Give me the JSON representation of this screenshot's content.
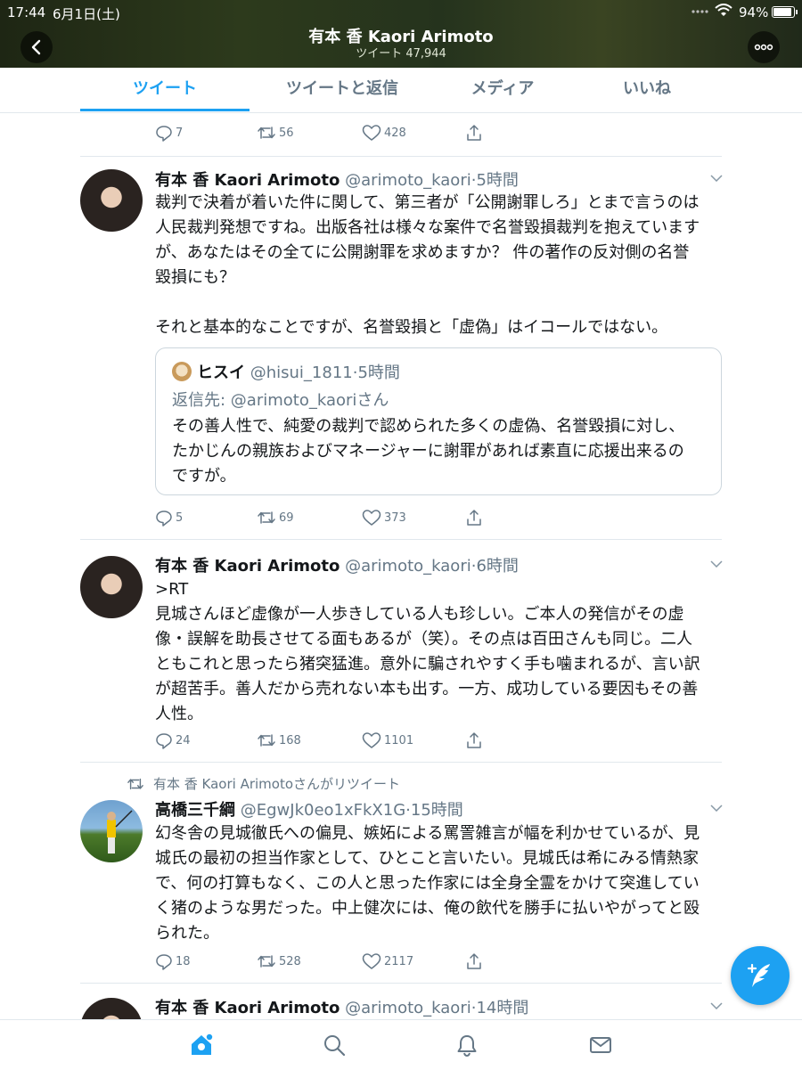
{
  "status_bar": {
    "time": "17:44",
    "date": "6月1日(土)",
    "battery": "94%"
  },
  "header": {
    "name": "有本 香  Kaori Arimoto",
    "tweet_count": "ツイート 47,944"
  },
  "tabs": [
    {
      "label": "ツイート",
      "active": true
    },
    {
      "label": "ツイートと返信",
      "active": false
    },
    {
      "label": "メディア",
      "active": false
    },
    {
      "label": "いいね",
      "active": false
    }
  ],
  "top_actions": {
    "replies": "7",
    "retweets": "56",
    "likes": "428"
  },
  "tweets": [
    {
      "name": "有本  香  Kaori Arimoto",
      "handle": "@arimoto_kaori",
      "time": "·5時間",
      "text_lines": [
        "裁判で決着が着いた件に関して、第三者が「公開謝罪しろ」とまで言うのは",
        "人民裁判発想ですね。出版各社は様々な案件で名誉毀損裁判を抱えています",
        "が、あなたはその全てに公開謝罪を求めますか？  件の著作の反対側の名誉",
        "毀損にも？",
        "",
        "それと基本的なことですが、名誉毀損と「虚偽」はイコールではない。"
      ],
      "quote": {
        "name": "ヒスイ",
        "handle": "@hisui_1811",
        "time": "·5時間",
        "reply_to": "返信先: @arimoto_kaoriさん",
        "text_lines": [
          "その善人性で、純愛の裁判で認められた多くの虚偽、名誉毀損に対し、",
          "たかじんの親族およびマネージャーに謝罪があれば素直に応援出来るの",
          "ですが。"
        ]
      },
      "replies": "5",
      "retweets": "69",
      "likes": "373"
    },
    {
      "name": "有本  香  Kaori Arimoto",
      "handle": "@arimoto_kaori",
      "time": "·6時間",
      "text_lines": [
        ">RT",
        "見城さんほど虚像が一人歩きしている人も珍しい。ご本人の発信がその虚",
        "像・誤解を助長させてる面もあるが（笑）。その点は百田さんも同じ。二人",
        "ともこれと思ったら猪突猛進。意外に騙されやすく手も噛まれるが、言い訳",
        "が超苦手。善人だから売れない本も出す。一方、成功している要因もその善",
        "人性。"
      ],
      "replies": "24",
      "retweets": "168",
      "likes": "1101"
    },
    {
      "retweeted_by": "有本  香  Kaori Arimotoさんがリツイート",
      "name": "高橋三千綱",
      "handle": "@EgwJk0eo1xFkX1G",
      "time": "·15時間",
      "text_lines": [
        "幻冬舎の見城徹氏への偏見、嫉妬による罵詈雑言が幅を利かせているが、見",
        "城氏の最初の担当作家として、ひとこと言いたい。見城氏は希にみる情熱家",
        "で、何の打算もなく、この人と思った作家には全身全霊をかけて突進してい",
        "く猪のような男だった。中上健次には、俺の飲代を勝手に払いやがってと殴",
        "られた。"
      ],
      "replies": "18",
      "retweets": "528",
      "likes": "2117"
    },
    {
      "name": "有本  香  Kaori Arimoto",
      "handle": "@arimoto_kaori",
      "time": "·14時間"
    }
  ],
  "icons": {
    "back": "chevron-left-icon",
    "more": "more-icon",
    "reply": "reply-icon",
    "retweet": "retweet-icon",
    "like": "heart-icon",
    "share": "share-icon",
    "compose": "compose-icon",
    "home": "home-icon",
    "search": "search-icon",
    "notifications": "bell-icon",
    "messages": "mail-icon"
  },
  "colors": {
    "accent": "#1da1f2",
    "secondary_text": "#657786",
    "primary_text": "#14171a",
    "divider": "#e1e8ed"
  }
}
